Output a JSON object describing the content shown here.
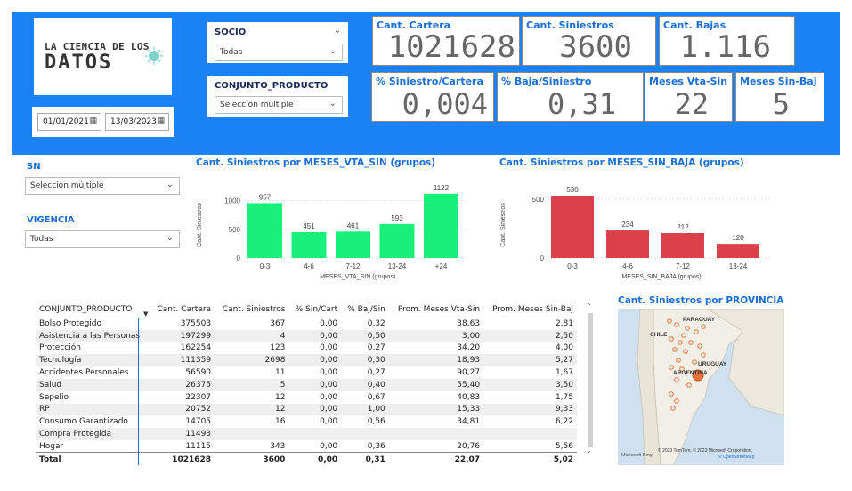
{
  "logo": {
    "line1": "LA CIENCIA DE LOS",
    "line2": "DATOS"
  },
  "dates": {
    "start": "01/01/2021",
    "end": "13/03/2023"
  },
  "slicers": {
    "socio": {
      "title": "SOCIO",
      "value": "Todas"
    },
    "conjunto_producto": {
      "title": "CONJUNTO_PRODUCTO",
      "value": "Selección múltiple"
    },
    "sn": {
      "title": "SN",
      "value": "Selección múltiple"
    },
    "vigencia": {
      "title": "VIGENCIA",
      "value": "Todas"
    }
  },
  "kpis": {
    "cant_cartera": {
      "label": "Cant. Cartera",
      "value": "1021628"
    },
    "cant_siniestros": {
      "label": "Cant. Siniestros",
      "value": "3600"
    },
    "cant_bajas": {
      "label": "Cant. Bajas",
      "value": "1.116"
    },
    "pct_siniestro_cartera": {
      "label": "% Siniestro/Cartera",
      "value": "0,004"
    },
    "pct_baja_siniestro": {
      "label": "% Baja/Siniestro",
      "value": "0,31"
    },
    "meses_vta_sin": {
      "label": "Meses Vta-Sin",
      "value": "22"
    },
    "meses_sin_baj": {
      "label": "Meses Sin-Baj",
      "value": "5"
    }
  },
  "chart_data": [
    {
      "type": "bar",
      "title": "Cant. Siniestros por MESES_VTA_SIN (grupos)",
      "xlabel": "MESES_VTA_SIN (grupos)",
      "ylabel": "Cant. Siniestros",
      "categories": [
        "0-3",
        "4-6",
        "7-12",
        "13-24",
        "+24"
      ],
      "values": [
        957,
        451,
        461,
        593,
        1122
      ],
      "yticks": [
        0,
        500,
        1000
      ],
      "ylim": [
        0,
        1150
      ],
      "color": "#19f07a"
    },
    {
      "type": "bar",
      "title": "Cant. Siniestros por MESES_SIN_BAJA (grupos)",
      "xlabel": "MESES_SIN_BAJA (grupos)",
      "ylabel": "Cant. Siniestros",
      "categories": [
        "0-3",
        "4-6",
        "7-12",
        "13-24"
      ],
      "values": [
        530,
        234,
        212,
        120
      ],
      "yticks": [
        0,
        500
      ],
      "ylim": [
        0,
        560
      ],
      "color": "#d9404a"
    }
  ],
  "table": {
    "headers": [
      "CONJUNTO_PRODUCTO",
      "Cant. Cartera",
      "Cant. Siniestros",
      "% Sin/Cart",
      "% Baj/Sin",
      "Prom. Meses Vta-Sin",
      "Prom. Meses Sin-Baj"
    ],
    "rows": [
      [
        "Bolso Protegido",
        "375503",
        "367",
        "0,00",
        "0,32",
        "38,63",
        "2,81"
      ],
      [
        "Asistencia a las Personas",
        "197299",
        "4",
        "0,00",
        "0,50",
        "3,00",
        "2,50"
      ],
      [
        "Protección",
        "162254",
        "123",
        "0,00",
        "0,27",
        "34,20",
        "4,00"
      ],
      [
        "Tecnología",
        "111359",
        "2698",
        "0,00",
        "0,30",
        "18,93",
        "5,27"
      ],
      [
        "Accidentes Personales",
        "56590",
        "11",
        "0,00",
        "0,27",
        "90,27",
        "1,67"
      ],
      [
        "Salud",
        "26375",
        "5",
        "0,00",
        "0,40",
        "55,40",
        "3,50"
      ],
      [
        "Sepelio",
        "22307",
        "12",
        "0,00",
        "0,67",
        "40,83",
        "1,75"
      ],
      [
        "RP",
        "20752",
        "12",
        "0,00",
        "1,00",
        "15,33",
        "9,33"
      ],
      [
        "Consumo Garantizado",
        "14705",
        "16",
        "0,00",
        "0,56",
        "34,81",
        "6,22"
      ],
      [
        "Compra Protegida",
        "11493",
        "",
        "",
        "",
        "",
        ""
      ],
      [
        "Hogar",
        "11115",
        "343",
        "0,00",
        "0,36",
        "20,76",
        "5,56"
      ]
    ],
    "total": [
      "Total",
      "1021628",
      "3600",
      "0,00",
      "0,31",
      "22,07",
      "5,02"
    ]
  },
  "map": {
    "title": "Cant. Siniestros por PROVINCIA",
    "labels": {
      "paraguay": "PARAGUAY",
      "chile": "CHILE",
      "uruguay": "URUGUAY",
      "argentina": "ARGENTINA"
    },
    "attribution": "© 2023 TomTom, © 2023 Microsoft Corporation,",
    "attribution2": "© OpenStreetMap",
    "brand": "Microsoft Bing"
  },
  "colors": {
    "banner": "#1a82f5",
    "accent": "#1a6fd6",
    "green_bar": "#19f07a",
    "red_bar": "#d9404a",
    "bubble": "#e8743b"
  },
  "icons": [
    "calendar-icon",
    "chevron-down-icon",
    "brain-icon",
    "sort-arrow-icon"
  ]
}
